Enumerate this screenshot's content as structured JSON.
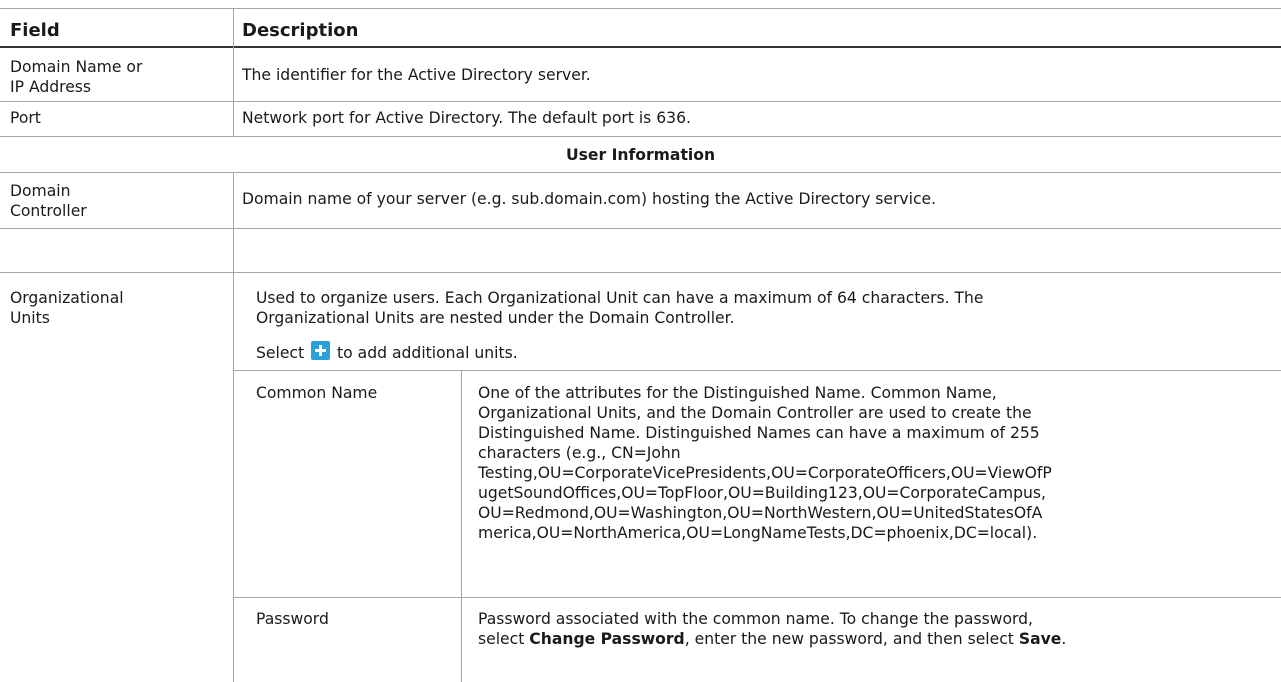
{
  "header": {
    "field": "Field",
    "description": "Description"
  },
  "rows": {
    "domain_name": {
      "field_line1": "Domain Name or",
      "field_line2": "IP Address",
      "description": "The identifier for the Active Directory server."
    },
    "port": {
      "field": "Port",
      "description": "Network port for Active Directory. The default port is 636."
    },
    "section_title": "User Information",
    "domain_controller": {
      "field_line1": "Domain",
      "field_line2": "Controller",
      "description": "Domain name of your server (e.g. sub.domain.com) hosting the Active Directory service."
    },
    "org_units": {
      "field_line1": "Organizational",
      "field_line2": "Units",
      "desc_line1": "Used to organize users. Each Organizational Unit can have a maximum of 64 characters. The",
      "desc_line2": "Organizational Units are nested under the Domain Controller.",
      "select_prefix": "Select",
      "select_suffix": "to add additional units.",
      "plus_icon": "add-plus-icon",
      "plus_color": "#2aa0d8"
    },
    "common_name": {
      "field": "Common Name",
      "lines": [
        "One of the attributes for the Distinguished Name. Common Name,",
        "Organizational Units, and the Domain Controller are used to create the",
        "Distinguished Name. Distinguished Names can have a maximum of 255",
        "characters (e.g., CN=John",
        "Testing,OU=CorporateVicePresidents,OU=CorporateOfficers,OU=ViewOfP",
        "ugetSoundOffices,OU=TopFloor,OU=Building123,OU=CorporateCampus,",
        "OU=Redmond,OU=Washington,OU=NorthWestern,OU=UnitedStatesOfA",
        "merica,OU=NorthAmerica,OU=LongNameTests,DC=phoenix,DC=local)."
      ]
    },
    "password": {
      "field": "Password",
      "line1": "Password associated with the common name. To change the password,",
      "line2_a": "select ",
      "line2_b": "Change Password",
      "line2_c": ", enter the new password, and then select ",
      "line2_d": "Save",
      "line2_e": "."
    }
  }
}
